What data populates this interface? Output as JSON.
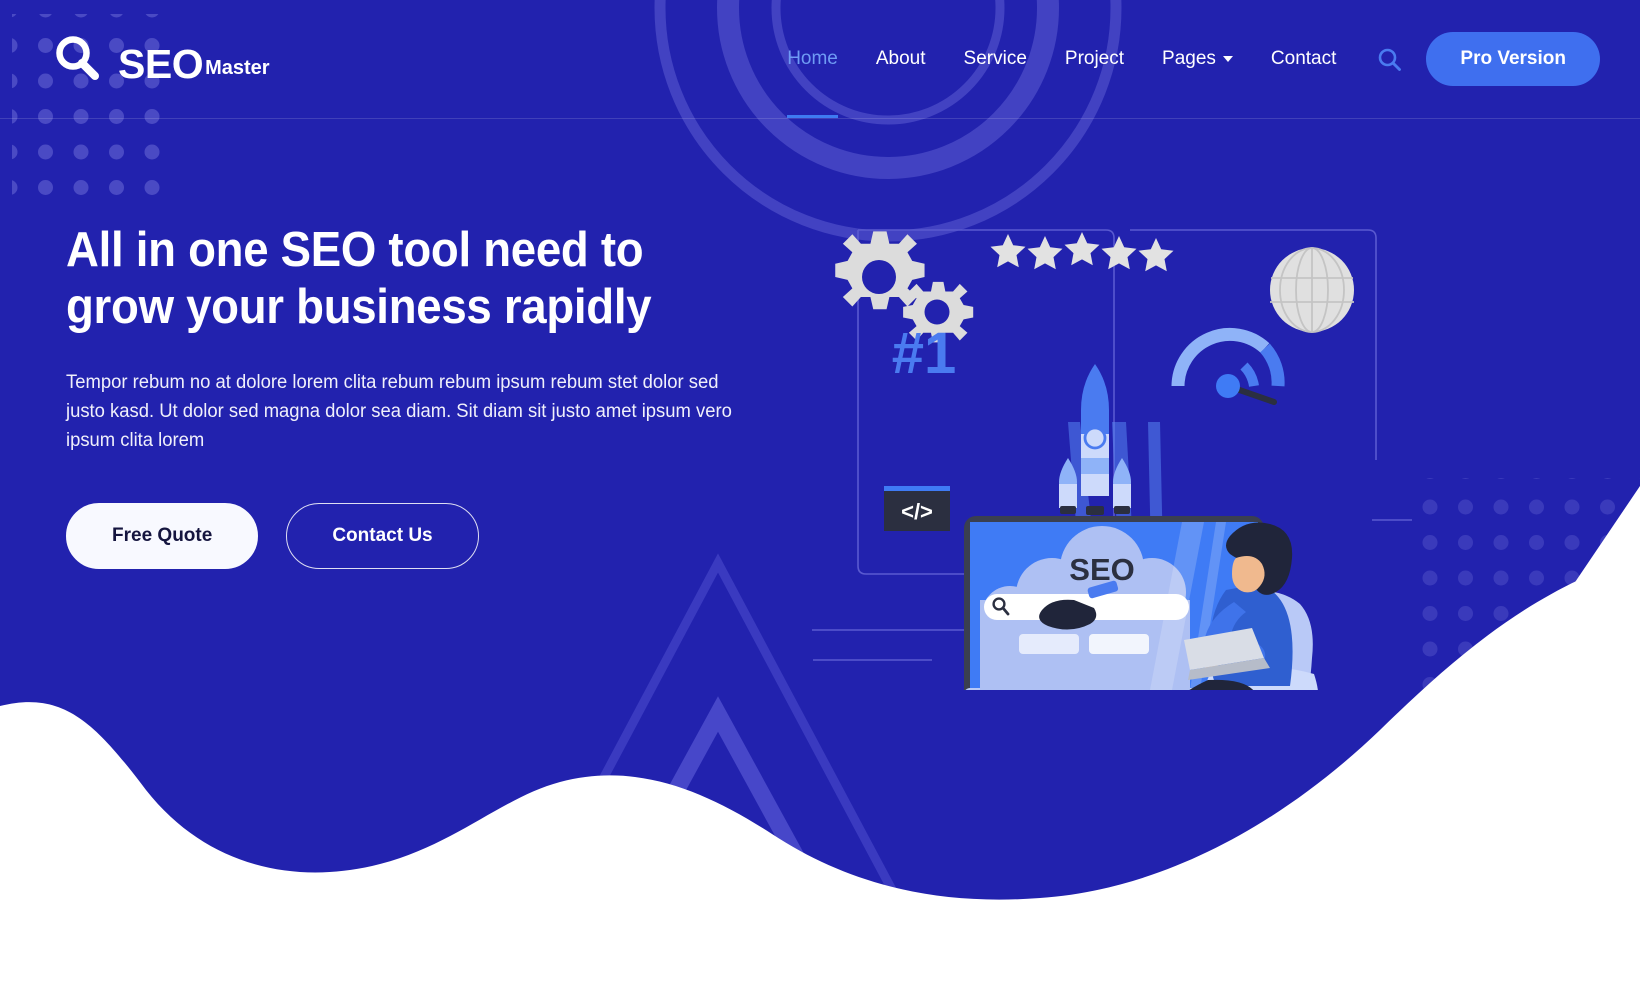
{
  "theme": {
    "bg_deep_blue": "#2222ae",
    "accent_blue": "#3f6fef",
    "active_link": "#6f9bf4",
    "underline": "#3e7bf2",
    "white": "#ffffff",
    "offwhite_button": "#f8f9ff",
    "dark_navy": "#2b2f40",
    "periwinkle": "#aec0f3",
    "screen_blue": "#3f7bf5",
    "grey_icon": "#dcdcdc"
  },
  "navbar": {
    "logo": {
      "icon": "magnifier-icon",
      "primary": "SEO",
      "secondary": "Master"
    },
    "links": [
      {
        "label": "Home",
        "active": true,
        "has_caret": false
      },
      {
        "label": "About",
        "active": false,
        "has_caret": false
      },
      {
        "label": "Service",
        "active": false,
        "has_caret": false
      },
      {
        "label": "Project",
        "active": false,
        "has_caret": false
      },
      {
        "label": "Pages",
        "active": false,
        "has_caret": true
      },
      {
        "label": "Contact",
        "active": false,
        "has_caret": false
      }
    ],
    "search_icon": "search-icon",
    "pro_button_label": "Pro Version"
  },
  "hero": {
    "title": "All in one SEO tool need to grow your business rapidly",
    "paragraph": "Tempor rebum no at dolore lorem clita rebum rebum ipsum rebum stet dolor sed justo kasd. Ut dolor sed magna dolor sea diam. Sit diam sit justo amet ipsum vero ipsum clita lorem",
    "primary_button": "Free Quote",
    "secondary_button": "Contact Us"
  },
  "illustration": {
    "name": "seo-analytics-illustration",
    "screen_cloud_label": "SEO",
    "rank_label": "#1",
    "code_label": "</>",
    "star_count": 5,
    "elements": [
      "gear-icon",
      "rank-number",
      "code-block-icon",
      "star-rating",
      "rocket-icon",
      "monitor-with-search",
      "globe-icon",
      "speedometer-icon",
      "person-with-laptop",
      "chair"
    ]
  },
  "decorations": [
    "dot-grid-top-left",
    "dot-grid-right",
    "concentric-rings-top",
    "chevron-arrows-bottom",
    "white-wave-bottom"
  ]
}
